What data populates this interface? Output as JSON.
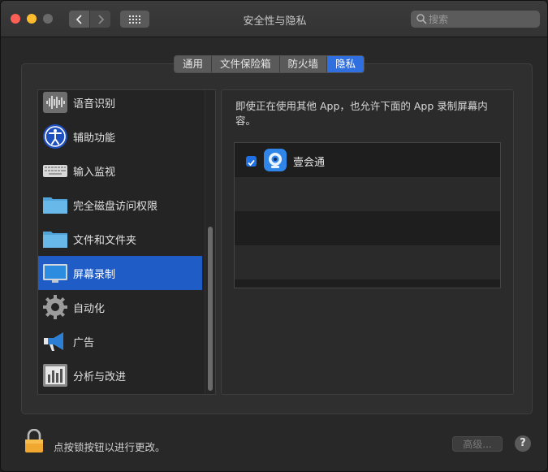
{
  "window": {
    "title": "安全性与隐私",
    "search_placeholder": "搜索",
    "icons": [
      "close-icon",
      "minimize-icon",
      "zoom-icon",
      "back-icon",
      "forward-icon",
      "grid-icon",
      "search-icon"
    ]
  },
  "tabs": [
    {
      "label": "通用",
      "active": false
    },
    {
      "label": "文件保险箱",
      "active": false
    },
    {
      "label": "防火墙",
      "active": false
    },
    {
      "label": "隐私",
      "active": true
    }
  ],
  "sidebar": {
    "items": [
      {
        "label": "语音识别",
        "icon": "speech-recognition-icon"
      },
      {
        "label": "辅助功能",
        "icon": "accessibility-icon"
      },
      {
        "label": "输入监视",
        "icon": "keyboard-icon"
      },
      {
        "label": "完全磁盘访问权限",
        "icon": "folder-icon"
      },
      {
        "label": "文件和文件夹",
        "icon": "folder-icon"
      },
      {
        "label": "屏幕录制",
        "icon": "display-icon",
        "selected": true
      },
      {
        "label": "自动化",
        "icon": "gear-icon"
      },
      {
        "label": "广告",
        "icon": "megaphone-icon"
      },
      {
        "label": "分析与改进",
        "icon": "analytics-icon"
      }
    ]
  },
  "detail": {
    "description": "即使正在使用其他 App，也允许下面的 App 录制屏幕内容。",
    "apps": [
      {
        "name": "壹会通",
        "checked": true,
        "icon": "webcam-app-icon"
      }
    ]
  },
  "footer": {
    "lock_text": "点按锁按钮以进行更改。",
    "advanced_label": "高级...",
    "help_label": "?"
  },
  "colors": {
    "accent": "#1f5cc6",
    "close": "#fe5f57",
    "minimize": "#febc2e"
  }
}
